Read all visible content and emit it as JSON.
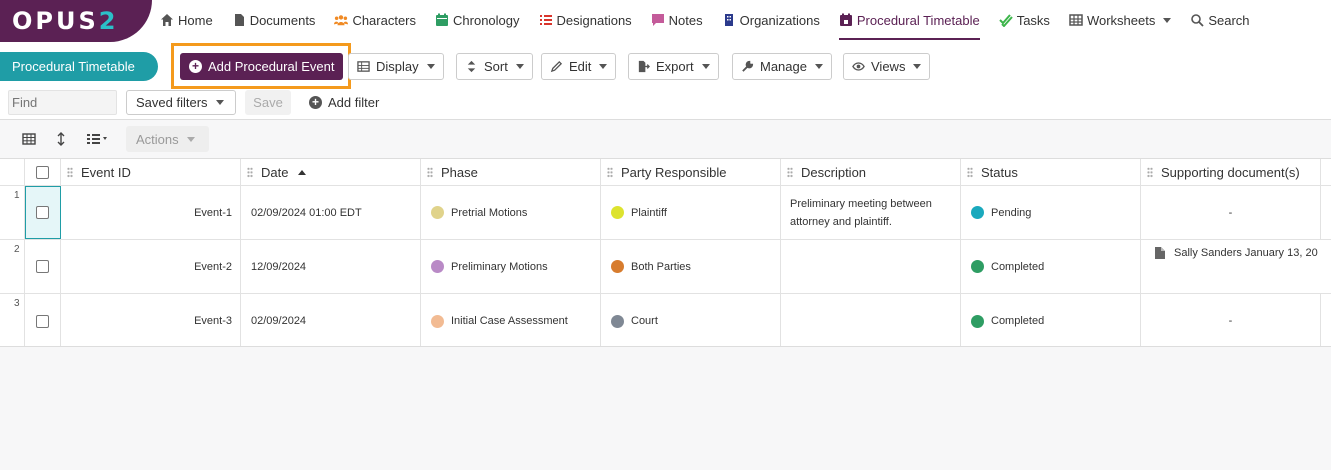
{
  "logo": {
    "main": "OPUS",
    "accent": "2"
  },
  "nav": [
    {
      "label": "Home",
      "icon": "home-icon"
    },
    {
      "label": "Documents",
      "icon": "document-icon"
    },
    {
      "label": "Characters",
      "icon": "people-icon"
    },
    {
      "label": "Chronology",
      "icon": "calendar-icon"
    },
    {
      "label": "Designations",
      "icon": "list-icon"
    },
    {
      "label": "Notes",
      "icon": "comment-icon"
    },
    {
      "label": "Organizations",
      "icon": "building-icon"
    },
    {
      "label": "Procedural Timetable",
      "icon": "calendar-event-icon",
      "active": true
    },
    {
      "label": "Tasks",
      "icon": "check-icon"
    },
    {
      "label": "Worksheets",
      "icon": "grid-icon"
    },
    {
      "label": "Search",
      "icon": "search-icon"
    }
  ],
  "toolbar": {
    "page_tab": "Procedural Timetable",
    "add_event": "Add Procedural Event",
    "display": "Display",
    "sort": "Sort",
    "edit": "Edit",
    "export": "Export",
    "manage": "Manage",
    "views": "Views",
    "find_placeholder": "Find",
    "saved_filters": "Saved filters",
    "save": "Save",
    "add_filter": "Add filter",
    "actions": "Actions"
  },
  "table": {
    "headers": [
      "Event ID",
      "Date",
      "Phase",
      "Party Responsible",
      "Description",
      "Status",
      "Supporting document(s)"
    ],
    "rows": [
      {
        "num": "1",
        "id": "Event-1",
        "date": "02/09/2024 01:00 EDT",
        "phase": "Pretrial Motions",
        "phase_color": "#e0d38b",
        "party": "Plaintiff",
        "party_color": "#dde32f",
        "description": "Preliminary meeting between attorney and plaintiff.",
        "status": "Pending",
        "status_color": "#1aa9bd",
        "docs": "-"
      },
      {
        "num": "2",
        "id": "Event-2",
        "date": "12/09/2024",
        "phase": "Preliminary Motions",
        "phase_color": "#b98ac6",
        "party": "Both Parties",
        "party_color": "#d77c2e",
        "description": "",
        "status": "Completed",
        "status_color": "#2e9d63",
        "docs": "Sally Sanders January 13, 20"
      },
      {
        "num": "3",
        "id": "Event-3",
        "date": "02/09/2024",
        "phase": "Initial Case Assessment",
        "phase_color": "#f2bb93",
        "party": "Court",
        "party_color": "#7f8894",
        "description": "",
        "status": "Completed",
        "status_color": "#2e9d63",
        "docs": "-"
      }
    ]
  },
  "colors": {
    "brand": "#5b2154",
    "accent": "#1f9da6",
    "highlight": "#f49a1d"
  }
}
